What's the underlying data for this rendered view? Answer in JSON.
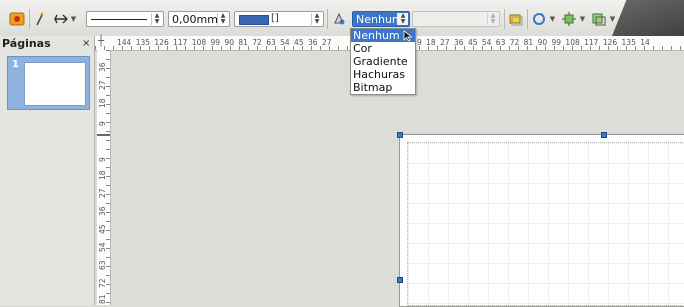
{
  "toolbar": {
    "line_width": "0,00mm",
    "line_color_label": "[]",
    "area_style_value": "Nenhum",
    "colors": {
      "accent": "#3c76c8",
      "line_color": "#3a66b4"
    }
  },
  "area_style_menu": {
    "options": [
      "Nenhum",
      "Cor",
      "Gradiente",
      "Hachuras",
      "Bitmap"
    ],
    "selected": "Nenhum"
  },
  "pages_panel": {
    "title": "Páginas",
    "close": "×",
    "thumbnails": [
      {
        "number": "1"
      }
    ]
  },
  "hruler": {
    "left_labels": "144 135 126 117 108 99 90 81 72 63 54 45 36 27",
    "right_labels": "9 18 27 36 45 54 63 72 81 90 99 108 117 126 135 14"
  },
  "vruler": {
    "top_labels": [
      "9",
      "18",
      "27",
      "36"
    ],
    "bottom_labels": [
      "9",
      "18",
      "27",
      "36",
      "45",
      "54",
      "63",
      "72",
      "81"
    ]
  }
}
